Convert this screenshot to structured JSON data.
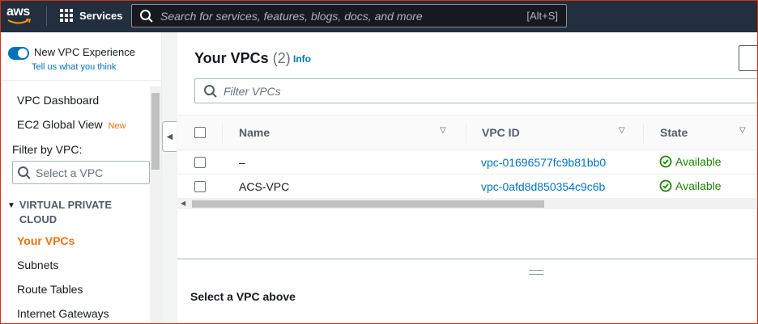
{
  "topnav": {
    "logo_text": "aws",
    "services_label": "Services",
    "search_placeholder": "Search for services, features, blogs, docs, and more",
    "search_shortcut": "[Alt+S]"
  },
  "sidebar": {
    "toggle_title": "New VPC Experience",
    "toggle_link": "Tell us what you think",
    "toggle_on": true,
    "items_top": [
      {
        "label": "VPC Dashboard"
      },
      {
        "label": "EC2 Global View",
        "badge": "New"
      }
    ],
    "filter_label": "Filter by VPC:",
    "select_placeholder": "Select a VPC",
    "section_title": "VIRTUAL PRIVATE CLOUD",
    "section_items": [
      {
        "label": "Your VPCs",
        "active": true
      },
      {
        "label": "Subnets"
      },
      {
        "label": "Route Tables"
      },
      {
        "label": "Internet Gateways"
      }
    ]
  },
  "main": {
    "title": "Your VPCs",
    "count": "(2)",
    "info": "Info",
    "filter_placeholder": "Filter VPCs",
    "columns": [
      "Name",
      "VPC ID",
      "State"
    ],
    "rows": [
      {
        "name": "–",
        "vpc_id": "vpc-01696577fc9b81bb0",
        "state": "Available"
      },
      {
        "name": "ACS-VPC",
        "vpc_id": "vpc-0afd8d850354c9c6b",
        "state": "Available"
      }
    ]
  },
  "split_panel": {
    "message": "Select a VPC above"
  },
  "colors": {
    "nav_bg": "#232f3e",
    "link": "#0073bb",
    "accent": "#ec7211",
    "success": "#1d8102"
  }
}
